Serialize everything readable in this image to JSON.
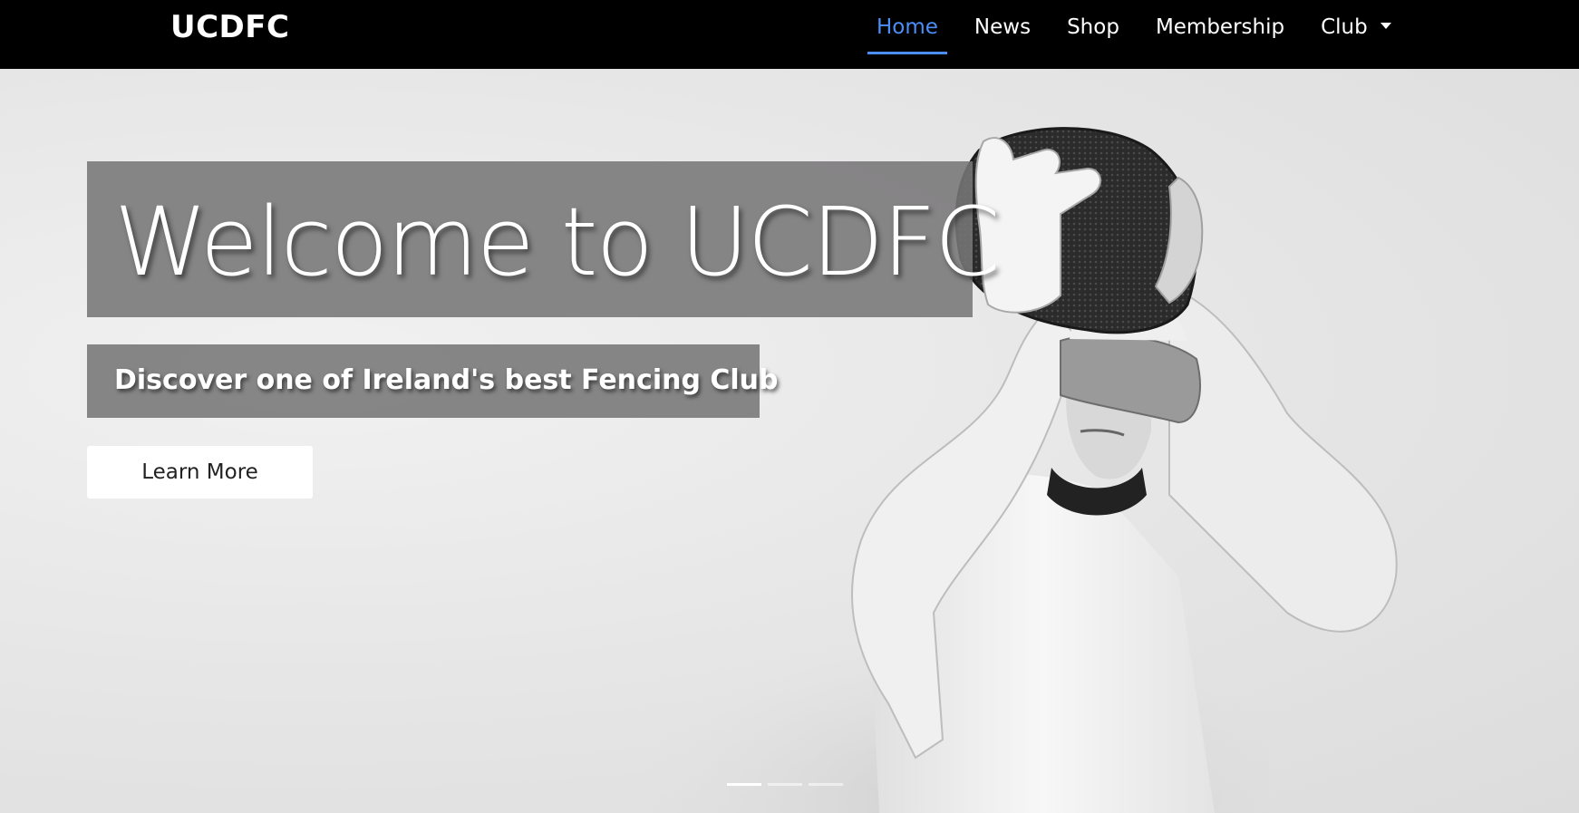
{
  "navbar": {
    "brand": "UCDFC",
    "items": [
      {
        "label": "Home",
        "active": true
      },
      {
        "label": "News"
      },
      {
        "label": "Shop"
      },
      {
        "label": "Membership"
      },
      {
        "label": "Club",
        "dropdown": true
      }
    ]
  },
  "hero": {
    "title": "Welcome to UCDFC",
    "subtitle": "Discover one of Ireland's best Fencing Club",
    "button_label": "Learn More",
    "carousel": {
      "slides": 3,
      "active_index": 0
    }
  },
  "colors": {
    "navbar_bg": "#000000",
    "active_link": "#4b8ef7",
    "caption_box": "#787678"
  }
}
